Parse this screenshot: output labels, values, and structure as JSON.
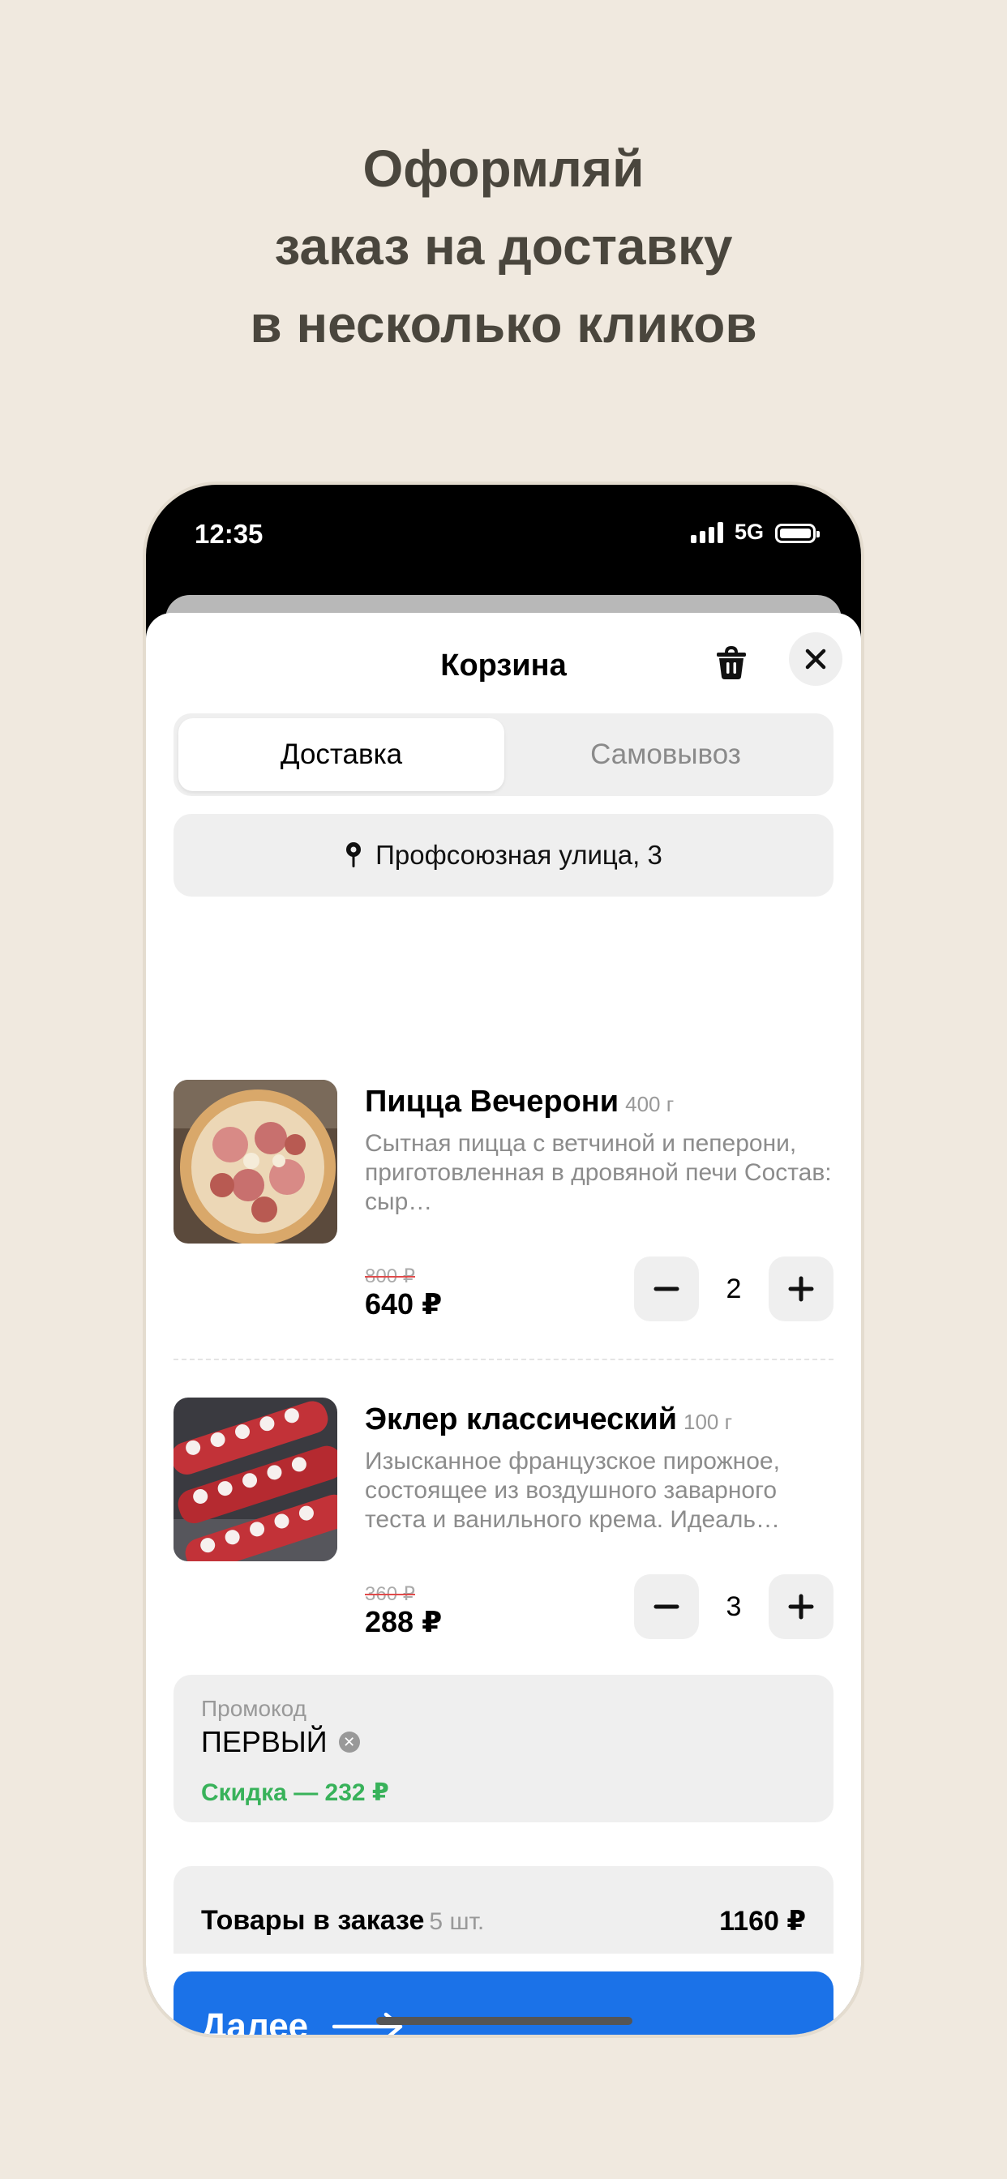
{
  "headline": {
    "line1": "Оформляй",
    "line2": "заказ на доставку",
    "line3": "в несколько кликов"
  },
  "status_bar": {
    "time": "12:35",
    "network": "5G"
  },
  "cart": {
    "title": "Корзина",
    "tabs": [
      {
        "label": "Доставка",
        "active": true
      },
      {
        "label": "Самовывоз",
        "active": false
      }
    ],
    "address": "Профсоюзная улица, 3",
    "items": [
      {
        "name": "Пицца Вечерони",
        "weight": "400 г",
        "description": "Сытная пицца с ветчиной и пеперони, приготовленная в дровяной печи Состав: сыр…",
        "old_price": "800 ₽",
        "price": "640 ₽",
        "quantity": "2"
      },
      {
        "name": "Эклер классический",
        "weight": "100 г",
        "description": "Изысканное французское пирожное, состоящее из воздушного заварного теста и ванильного крема. Идеаль…",
        "old_price": "360 ₽",
        "price": "288 ₽",
        "quantity": "3"
      }
    ],
    "promo": {
      "label": "Промокод",
      "code": "ПЕРВЫЙ",
      "discount": "Скидка — 232 ₽"
    },
    "summary": {
      "label": "Товары в заказе",
      "count": "5 шт.",
      "total": "1160 ₽"
    },
    "next_button": "Далее"
  },
  "colors": {
    "background": "#f0e9df",
    "accent": "#1b72e8",
    "discount": "#38b25a",
    "strike": "#e04a4a"
  }
}
